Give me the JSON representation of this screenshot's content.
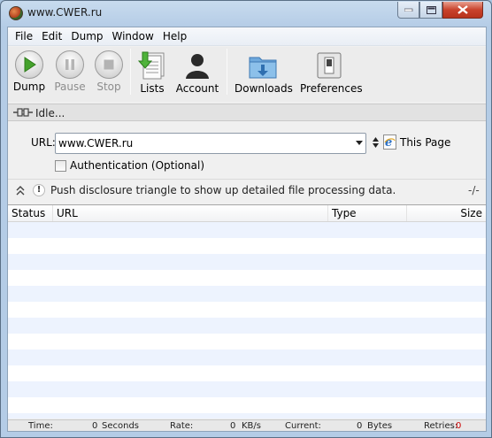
{
  "window": {
    "title": "www.CWER.ru"
  },
  "menubar": {
    "items": [
      "File",
      "Edit",
      "Dump",
      "Window",
      "Help"
    ]
  },
  "toolbar": {
    "dump": "Dump",
    "pause": "Pause",
    "stop": "Stop",
    "lists": "Lists",
    "account": "Account",
    "downloads": "Downloads",
    "preferences": "Preferences"
  },
  "status": {
    "text": "Idle..."
  },
  "url": {
    "label": "URL:",
    "value": "www.CWER.ru",
    "this_page": "This Page"
  },
  "auth": {
    "label": "Authentication (Optional)",
    "checked": false
  },
  "disclosure": {
    "text": "Push disclosure triangle to show up detailed file processing data.",
    "right": "-/-"
  },
  "table": {
    "columns": [
      "Status",
      "URL",
      "Type",
      "Size"
    ],
    "rows": []
  },
  "footer": {
    "time_label": "Time:",
    "time_value": "0",
    "time_unit": "Seconds",
    "rate_label": "Rate:",
    "rate_value": "0",
    "rate_unit": "KB/s",
    "current_label": "Current:",
    "current_value": "0",
    "current_unit": "Bytes",
    "retries_label": "Retries:",
    "retries_value": "0"
  },
  "colors": {
    "accent_play": "#45a22c",
    "retries": "#cc0000",
    "row_alt": "#edf3fe"
  }
}
